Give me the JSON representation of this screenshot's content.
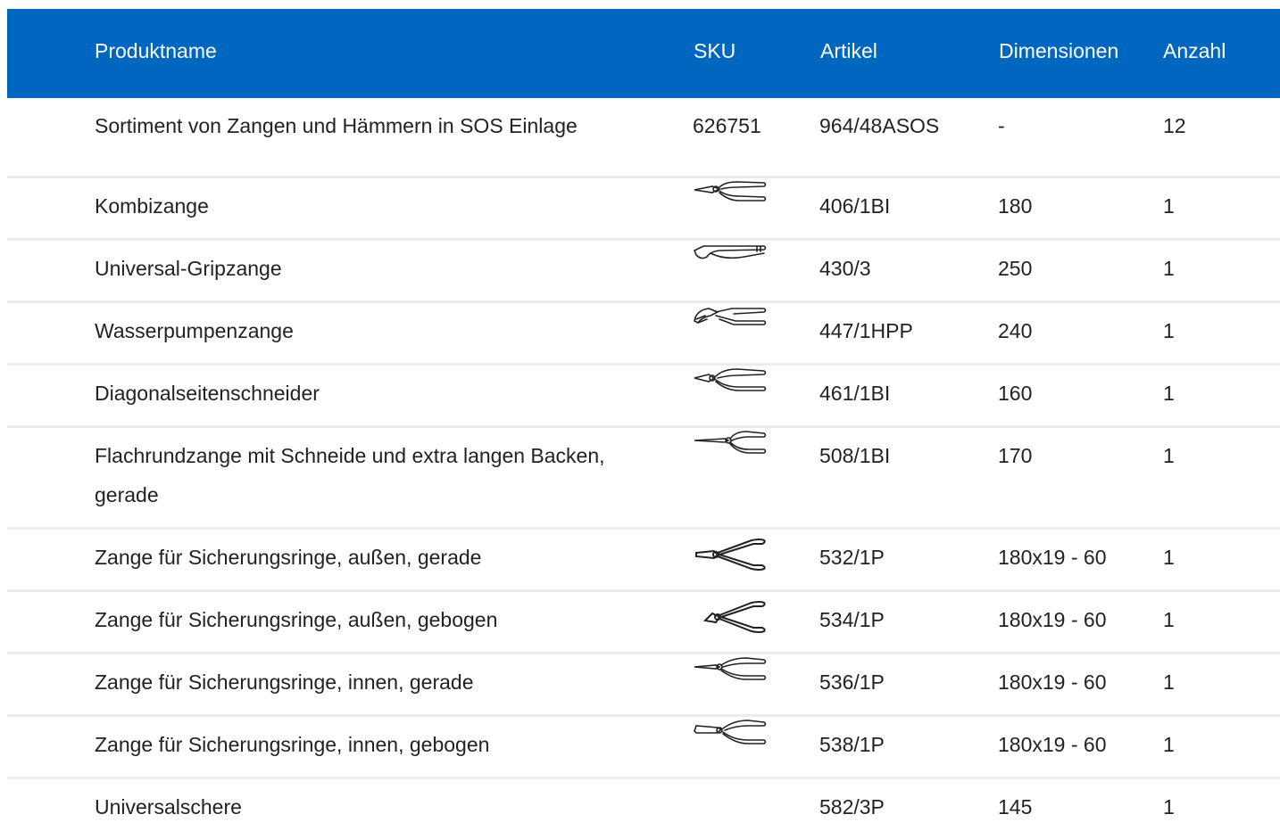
{
  "header": {
    "name": "Produktname",
    "sku": "SKU",
    "article": "Artikel",
    "dimensions": "Dimensionen",
    "quantity": "Anzahl"
  },
  "rows": [
    {
      "name": "Sortiment von Zangen und Hämmern in SOS Einlage",
      "sku": "626751",
      "article": "964/48ASOS",
      "dimensions": "-",
      "quantity": "12"
    },
    {
      "name": "Kombizange",
      "icon": "combination-pliers-icon",
      "article": "406/1BI",
      "dimensions": "180",
      "quantity": "1"
    },
    {
      "name": "Universal-Gripzange",
      "icon": "locking-pliers-icon",
      "article": "430/3",
      "dimensions": "250",
      "quantity": "1"
    },
    {
      "name": "Wasserpumpenzange",
      "icon": "water-pump-pliers-icon",
      "article": "447/1HPP",
      "dimensions": "240",
      "quantity": "1"
    },
    {
      "name": "Diagonalseitenschneider",
      "icon": "diagonal-cutter-icon",
      "article": "461/1BI",
      "dimensions": "160",
      "quantity": "1"
    },
    {
      "name": "Flachrundzange mit Schneide und extra langen Backen, gerade",
      "icon": "long-nose-pliers-icon",
      "article": "508/1BI",
      "dimensions": "170",
      "quantity": "1"
    },
    {
      "name": "Zange für Sicherungsringe, außen, gerade",
      "icon": "circlip-pliers-external-straight-icon",
      "article": "532/1P",
      "dimensions": "180x19 - 60",
      "quantity": "1"
    },
    {
      "name": "Zange für Sicherungsringe, außen, gebogen",
      "icon": "circlip-pliers-external-bent-icon",
      "article": "534/1P",
      "dimensions": "180x19 - 60",
      "quantity": "1"
    },
    {
      "name": "Zange für Sicherungsringe, innen, gerade",
      "icon": "circlip-pliers-internal-straight-icon",
      "article": "536/1P",
      "dimensions": "180x19 - 60",
      "quantity": "1"
    },
    {
      "name": "Zange für Sicherungsringe, innen, gebogen",
      "icon": "circlip-pliers-internal-bent-icon",
      "article": "538/1P",
      "dimensions": "180x19 - 60",
      "quantity": "1"
    },
    {
      "name": "Universalschere",
      "article": "582/3P",
      "dimensions": "145",
      "quantity": "1"
    }
  ],
  "colors": {
    "header_bg": "#0067c0",
    "header_text": "#ffffff",
    "row_divider": "#ececec"
  }
}
